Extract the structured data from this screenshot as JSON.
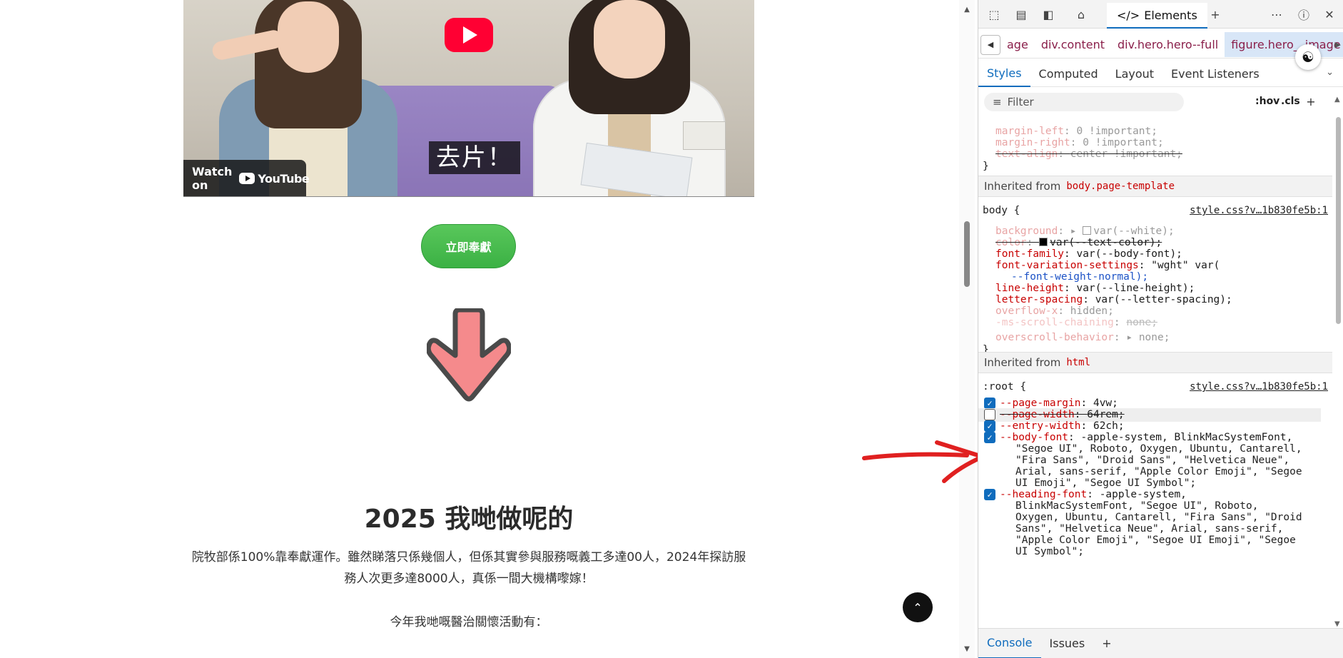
{
  "page": {
    "video": {
      "subtitle": "去片！",
      "watch_on_label": "Watch on",
      "youtube_logo_text": "YouTube"
    },
    "donate_button_label": "立即奉獻",
    "section_title": "2025 我哋做呢的",
    "section_body": "院牧部係100%靠奉獻運作。雖然睇落只係幾個人，但係其實參與服務嘅義工多達00人，2024年探訪服務人次更多達8000人，真係一間大機構嚟嫁！",
    "section_sub": "今年我哋嘅醫治關懷活動有：",
    "to_top_icon": "chevron-up-icon"
  },
  "devtools": {
    "top_tab_label": "Elements",
    "breadcrumbs": [
      "age",
      "div.content",
      "div.hero.hero--full",
      "figure.hero__image"
    ],
    "subtabs": [
      "Styles",
      "Computed",
      "Layout",
      "Event Listeners"
    ],
    "filter_placeholder": "Filter",
    "filter_hov": ":hov",
    "filter_cls": ".cls",
    "rule1": {
      "lines": [
        {
          "prop": "margin-left",
          "value": "0 !important;",
          "strike": false
        },
        {
          "prop": "margin-right",
          "value": "0 !important;",
          "strike": false
        },
        {
          "prop": "text-align",
          "value": "center !important;",
          "strike": true
        }
      ],
      "close": "}"
    },
    "inherited_body": {
      "label": "Inherited from",
      "selector": "body.page-template"
    },
    "body_rule": {
      "selector": "body {",
      "source": "style.css?v…1b830fe5b:1",
      "background_prop": "background",
      "background_val": "var(--white);",
      "color_prop": "color",
      "color_val": "var(--text-color);",
      "font_family_prop": "font-family",
      "font_family_val": "var(--body-font);",
      "fvs_prop": "font-variation-settings",
      "fvs_val": "\"wght\" var(",
      "fvs_val2": "--font-weight-normal);",
      "lh_prop": "line-height",
      "lh_val": "var(--line-height);",
      "ls_prop": "letter-spacing",
      "ls_val": "var(--letter-spacing);",
      "ox_prop": "overflow-x",
      "ox_val": "hidden;",
      "ms_prop": "-ms-scroll-chaining",
      "ms_val": "none;",
      "ob_prop": "overscroll-behavior",
      "ob_val": "none;",
      "close": "}"
    },
    "inherited_html": {
      "label": "Inherited from",
      "selector": "html"
    },
    "root_rule": {
      "selector": ":root {",
      "source": "style.css?v…1b830fe5b:1",
      "page_margin_prop": "--page-margin",
      "page_margin_val": "4vw;",
      "page_width_prop": "--page-width",
      "page_width_val": "64rem;",
      "entry_width_prop": "--entry-width",
      "entry_width_val": "62ch;",
      "body_font_prop": "--body-font",
      "body_font_l1": "-apple-system, BlinkMacSystemFont,",
      "body_font_l2": "\"Segoe UI\", Roboto, Oxygen, Ubuntu, Cantarell,",
      "body_font_l3": "\"Fira Sans\", \"Droid Sans\", \"Helvetica Neue\",",
      "body_font_l4": "Arial, sans-serif, \"Apple Color Emoji\", \"Segoe",
      "body_font_l5": "UI Emoji\", \"Segoe UI Symbol\";",
      "heading_font_prop": "--heading-font",
      "heading_font_l1": "-apple-system,",
      "heading_font_l2": "BlinkMacSystemFont, \"Segoe UI\", Roboto,",
      "heading_font_l3": "Oxygen, Ubuntu, Cantarell, \"Fira Sans\", \"Droid",
      "heading_font_l4": "Sans\", \"Helvetica Neue\", Arial, sans-serif,",
      "heading_font_l5": "\"Apple Color Emoji\", \"Segoe UI Emoji\", \"Segoe",
      "heading_font_l6": "UI Symbol\";"
    },
    "bottom_tabs": [
      "Console",
      "Issues"
    ]
  },
  "colors": {
    "accent": "#0f6cbd",
    "css_prop": "#c80000",
    "donate_green": "#3bb144",
    "annotation_red": "#e02020",
    "arrow_fill": "#f58a8c"
  }
}
